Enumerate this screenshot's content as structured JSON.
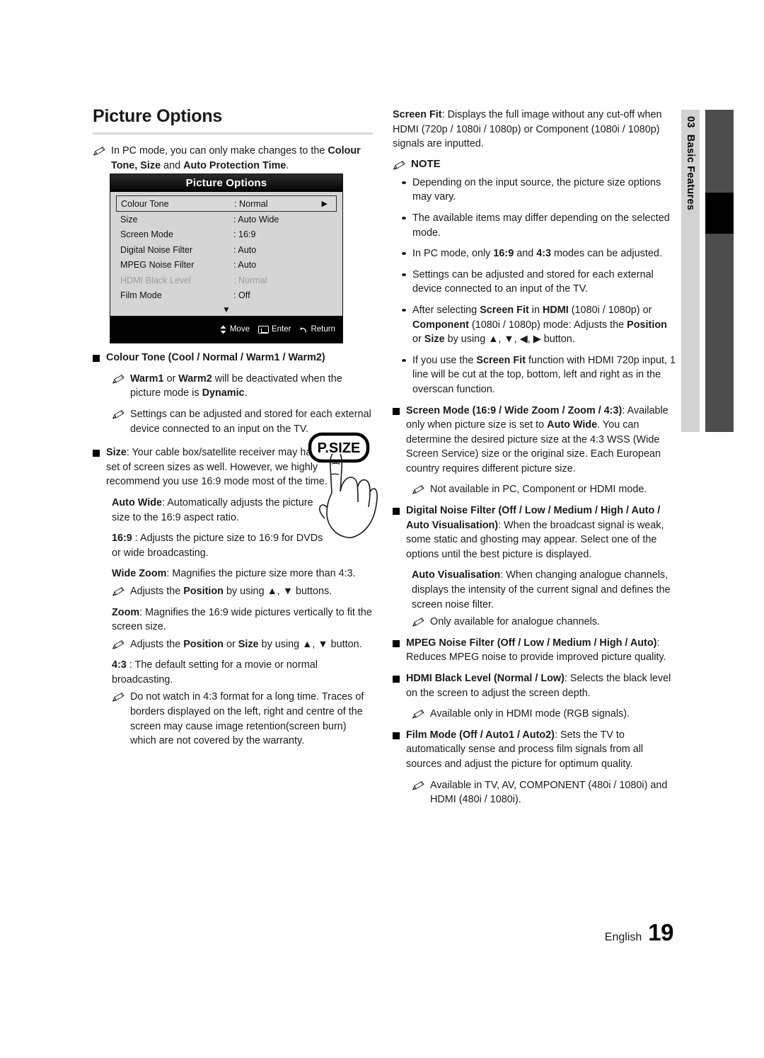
{
  "page_title": "Picture Options",
  "side_tab": {
    "chapter_number": "03",
    "chapter_label": "Basic Features"
  },
  "intro_note": {
    "text_1": "In PC mode, you can only make changes to the ",
    "bold_1": "Colour Tone, Size",
    "text_2": " and ",
    "bold_2": "Auto Protection Time",
    "text_3": "."
  },
  "osd": {
    "title": "Picture Options",
    "rows": [
      {
        "label": "Colour Tone",
        "value": ": Normal",
        "selected": true,
        "arrow": "▶",
        "dim": false
      },
      {
        "label": "Size",
        "value": ": Auto Wide",
        "selected": false,
        "arrow": "",
        "dim": false
      },
      {
        "label": "Screen Mode",
        "value": ": 16:9",
        "selected": false,
        "arrow": "",
        "dim": false
      },
      {
        "label": "Digital Noise Filter",
        "value": ": Auto",
        "selected": false,
        "arrow": "",
        "dim": false
      },
      {
        "label": "MPEG Noise Filter",
        "value": ": Auto",
        "selected": false,
        "arrow": "",
        "dim": false
      },
      {
        "label": "HDMI Black Level",
        "value": ": Normal",
        "selected": false,
        "arrow": "",
        "dim": true
      },
      {
        "label": "Film Mode",
        "value": ": Off",
        "selected": false,
        "arrow": "",
        "dim": false
      }
    ],
    "scroll_down": "▼",
    "footer": {
      "move": "Move",
      "enter": "Enter",
      "return": "Return"
    }
  },
  "psize_button_label": "P.SIZE",
  "left_column": {
    "colour_tone": {
      "heading": "Colour Tone (Cool / Normal / Warm1 / Warm2)",
      "note_1": {
        "b1": "Warm1",
        "t1": " or ",
        "b2": "Warm2",
        "t2": " will be deactivated when the picture mode is ",
        "b3": "Dynamic",
        "t3": "."
      },
      "note_2": "Settings can be adjusted and stored for each external device connected to an input on the TV."
    },
    "size": {
      "heading_bold": "Size",
      "heading_text": ": Your cable box/satellite receiver may have its own set of screen sizes as well. However, we highly recommend you use 16:9 mode most of the time.",
      "auto_wide_bold": "Auto Wide",
      "auto_wide_text": ": Automatically adjusts the picture size to the 16:9 aspect ratio.",
      "ratio169_bold": "16:9",
      "ratio169_text": " : Adjusts the picture size to 16:9 for DVDs or wide broadcasting.",
      "wide_zoom_bold": "Wide Zoom",
      "wide_zoom_text": ": Magnifies the picture size more than 4:3.",
      "wide_zoom_note": {
        "t1": "Adjusts the ",
        "b1": "Position",
        "t2": " by using ▲, ▼ buttons."
      },
      "zoom_bold": "Zoom",
      "zoom_text": ": Magnifies the 16:9 wide pictures vertically to fit the screen size.",
      "zoom_note": {
        "t1": "Adjusts the ",
        "b1": "Position",
        "t2": " or ",
        "b2": "Size",
        "t3": " by using ▲, ▼ button."
      },
      "ratio43_bold": "4:3",
      "ratio43_text": " : The default setting for a movie or normal broadcasting.",
      "ratio43_note": "Do not watch in 4:3 format for a long time. Traces of borders displayed on the left, right and centre of the screen may cause image retention(screen burn) which are not covered by the warranty."
    }
  },
  "right_column": {
    "screen_fit": {
      "bold": "Screen Fit",
      "text": ": Displays the full image without any cut-off when HDMI (720p / 1080i / 1080p) or Component (1080i / 1080p) signals are inputted."
    },
    "note_heading": "NOTE",
    "notes": [
      {
        "parts": [
          {
            "t": "Depending on the input source, the picture size options may vary."
          }
        ]
      },
      {
        "parts": [
          {
            "t": "The available items may differ depending on the selected mode."
          }
        ]
      },
      {
        "parts": [
          {
            "t": "In PC mode, only "
          },
          {
            "b": "16:9"
          },
          {
            "t": " and "
          },
          {
            "b": "4:3"
          },
          {
            "t": " modes can be adjusted."
          }
        ]
      },
      {
        "parts": [
          {
            "t": "Settings can be adjusted and stored for each external device connected to an input of the TV."
          }
        ]
      },
      {
        "parts": [
          {
            "t": "After selecting "
          },
          {
            "b": "Screen Fit"
          },
          {
            "t": " in "
          },
          {
            "b": "HDMI"
          },
          {
            "t": " (1080i / 1080p) or "
          },
          {
            "b": "Component"
          },
          {
            "t": " (1080i / 1080p) mode: Adjusts the "
          },
          {
            "b": "Position"
          },
          {
            "t": " or "
          },
          {
            "b": "Size"
          },
          {
            "t": " by using ▲, ▼, ◀, ▶ button."
          }
        ]
      },
      {
        "parts": [
          {
            "t": "If you use the "
          },
          {
            "b": "Screen Fit"
          },
          {
            "t": " function with HDMI 720p input, 1 line will be cut at the top, bottom, left and right as in the overscan function."
          }
        ]
      }
    ],
    "screen_mode": {
      "heading_bold": "Screen Mode (16:9 / Wide Zoom / Zoom / 4:3)",
      "text_1": ": Available only when picture size is set to ",
      "bold_1": "Auto Wide",
      "text_2": ". You can determine the desired picture size at the 4:3 WSS (Wide Screen Service) size or the original size. Each European country requires different picture size.",
      "note": "Not available in PC, Component or HDMI mode."
    },
    "digital_noise_filter": {
      "heading_bold": "Digital Noise Filter (Off / Low / Medium / High / Auto / Auto Visualisation)",
      "text": ": When the broadcast signal is weak, some static and ghosting may appear. Select one of the options until the best picture is displayed.",
      "auto_vis_bold": "Auto Visualisation",
      "auto_vis_text": ": When changing analogue channels, displays the intensity of the current signal and defines the screen noise filter.",
      "note": "Only available for analogue channels."
    },
    "mpeg_noise_filter": {
      "heading_bold": "MPEG Noise Filter (Off / Low / Medium / High / Auto)",
      "text": ": Reduces MPEG noise to provide improved picture quality."
    },
    "hdmi_black_level": {
      "heading_bold": "HDMI Black Level (Normal / Low)",
      "text": ": Selects the black level on the screen to adjust the screen depth.",
      "note": "Available only in HDMI mode (RGB signals)."
    },
    "film_mode": {
      "heading_bold": "Film Mode (Off / Auto1 / Auto2)",
      "text": ": Sets the TV to automatically sense and process film signals from all sources and adjust the picture for optimum quality.",
      "note": "Available in TV, AV, COMPONENT (480i / 1080i) and HDMI (480i / 1080i)."
    }
  },
  "footer": {
    "language": "English",
    "page_number": "19"
  }
}
